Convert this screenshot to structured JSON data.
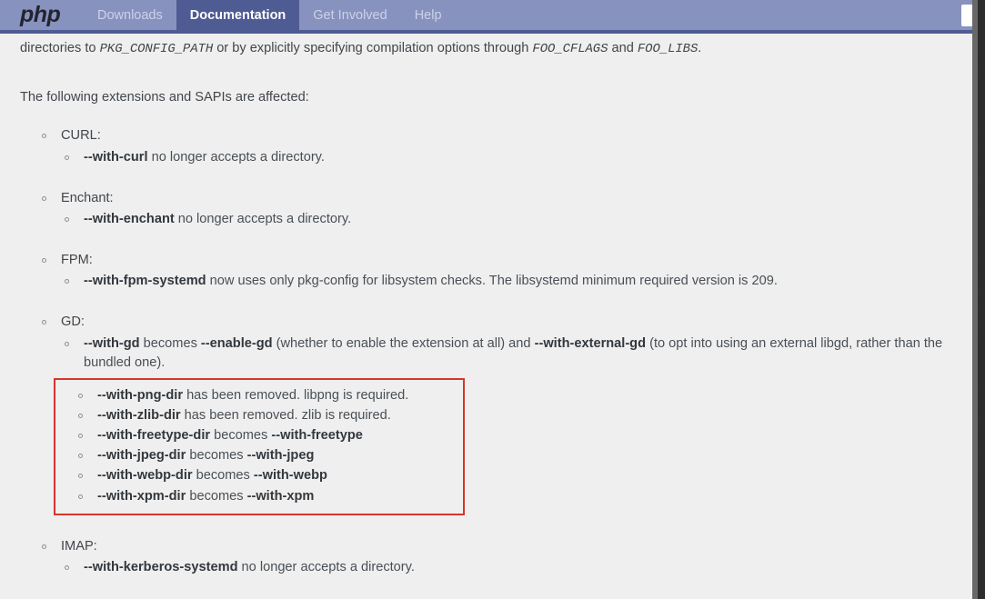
{
  "navbar": {
    "logo_text": "php",
    "items": [
      {
        "label": "Downloads",
        "active": false
      },
      {
        "label": "Documentation",
        "active": true
      },
      {
        "label": "Get Involved",
        "active": false
      },
      {
        "label": "Help",
        "active": false
      }
    ],
    "search_placeholder": "",
    "search_value": "",
    "bg_color": "#8892bf",
    "active_bg_color": "#4f5b93",
    "border_color": "#4f5b93"
  },
  "content": {
    "paragraph_1": {
      "part_1": "directories to ",
      "code_1": "PKG_CONFIG_PATH",
      "part_2": " or by explicitly specifying compilation options through ",
      "code_2": "FOO_CFLAGS",
      "part_3": " and ",
      "code_3": "FOO_LIBS",
      "part_4": "."
    },
    "paragraph_2": "The following extensions and SAPIs are affected:",
    "groups": [
      {
        "label": "CURL:",
        "items": [
          {
            "flag": "--with-curl",
            "text": " no longer accepts a directory."
          }
        ]
      },
      {
        "label": "Enchant:",
        "items": [
          {
            "flag": "--with-enchant",
            "text": " no longer accepts a directory."
          }
        ]
      },
      {
        "label": "FPM:",
        "items": [
          {
            "flag": "--with-fpm-systemd",
            "text": " now uses only pkg-config for libsystem checks. The libsystemd minimum required version is 209."
          }
        ]
      },
      {
        "label": "GD:",
        "items": [
          {
            "flag": "--with-gd",
            "text_a": " becomes ",
            "flag_b": "--enable-gd",
            "text_b": " (whether to enable the extension at all) and ",
            "flag_c": "--with-external-gd",
            "text_c": " (to opt into using an external libgd, rather than the bundled one)."
          }
        ]
      },
      {
        "label": "IMAP:",
        "items": [
          {
            "flag": "--with-kerberos-systemd",
            "text": " no longer accepts a directory."
          }
        ]
      }
    ],
    "highlight_box": {
      "border_color": "#d8342b",
      "items": [
        {
          "flag": "--with-png-dir",
          "text": " has been removed. libpng is required.",
          "flag2": ""
        },
        {
          "flag": "--with-zlib-dir",
          "text": " has been removed. zlib is required.",
          "flag2": ""
        },
        {
          "flag": "--with-freetype-dir",
          "text": " becomes ",
          "flag2": "--with-freetype"
        },
        {
          "flag": "--with-jpeg-dir",
          "text": " becomes ",
          "flag2": "--with-jpeg"
        },
        {
          "flag": "--with-webp-dir",
          "text": " becomes ",
          "flag2": "--with-webp"
        },
        {
          "flag": "--with-xpm-dir",
          "text": " becomes ",
          "flag2": "--with-xpm"
        }
      ]
    }
  },
  "scrollbar": {
    "track_color": "#2b2b2b",
    "thumb_color": "#686868"
  }
}
